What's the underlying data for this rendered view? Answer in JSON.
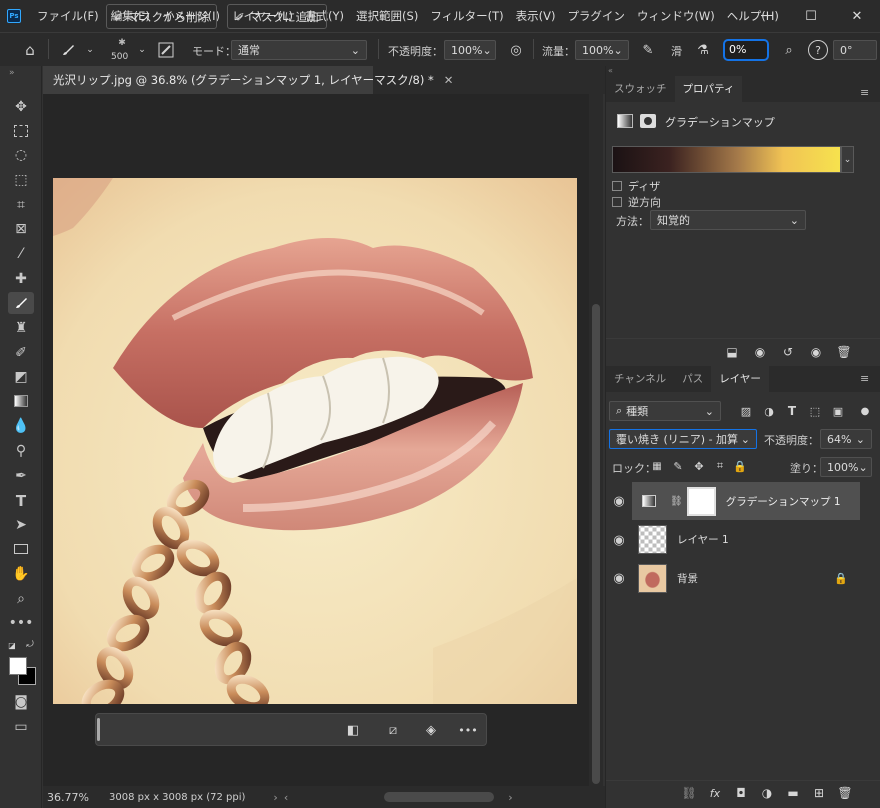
{
  "app": {
    "logo": "Ps",
    "menu": [
      "ファイル(F)",
      "編集(E)",
      "イメージ(I)",
      "レイヤー(L)",
      "書式(Y)",
      "選択範囲(S)",
      "フィルター(T)",
      "表示(V)",
      "プラグイン",
      "ウィンドウ(W)",
      "ヘルプ(H)"
    ],
    "window_buttons": [
      "minimize-icon",
      "maximize-icon",
      "close-icon"
    ]
  },
  "options": {
    "brush_size": "500",
    "mode_label": "モード：",
    "mode_value": "通常",
    "opacity_label": "不透明度：",
    "opacity_value": "100%",
    "flow_label": "流量：",
    "flow_value": "100%",
    "smooth_label": "滑",
    "smooth_value": "0%",
    "angle_value": "0°"
  },
  "document": {
    "tab_title": "光沢リップ.jpg @ 36.8% (グラデーションマップ 1, レイヤーマスク/8) *",
    "zoom": "36.77%",
    "dimensions": "3008 px x 3008 px (72 ppi)"
  },
  "contextual_bar": {
    "remove_label": "マスクから削除",
    "add_label": "マスクに追加",
    "more": "•••"
  },
  "properties": {
    "tabs": [
      "スウォッチ",
      "プロパティ"
    ],
    "title": "グラデーションマップ",
    "gradient_colors": [
      "#1b1214",
      "#4a2a24",
      "#a57a4a",
      "#f1c354",
      "#f6e24e"
    ],
    "dither_label": "ディザ",
    "reverse_label": "逆方向",
    "method_label": "方法：",
    "method_value": "知覚的"
  },
  "layers_panel": {
    "tabs": [
      "チャンネル",
      "パス",
      "レイヤー"
    ],
    "filter_value": "種類",
    "blend_mode": "覆い焼き (リニア) - 加算",
    "opacity_label": "不透明度：",
    "opacity_value": "64%",
    "lock_label": "ロック：",
    "fill_label": "塗り：",
    "fill_value": "100%",
    "layers": [
      {
        "name": "グラデーションマップ 1",
        "selected": true
      },
      {
        "name": "レイヤー 1",
        "selected": false
      },
      {
        "name": "背景",
        "selected": false
      }
    ]
  }
}
